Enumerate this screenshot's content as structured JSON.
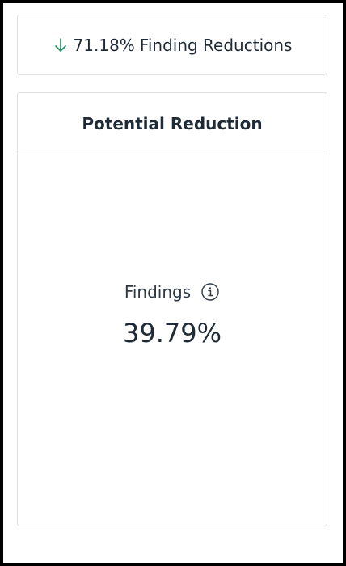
{
  "summary": {
    "value": "71.18%",
    "label": "Finding Reductions",
    "icon": "arrow-down-icon",
    "accent_color": "#1f8a5a"
  },
  "panel": {
    "title": "Potential Reduction",
    "metric_label": "Findings",
    "metric_info_icon": "info-icon",
    "metric_value": "39.79%"
  }
}
